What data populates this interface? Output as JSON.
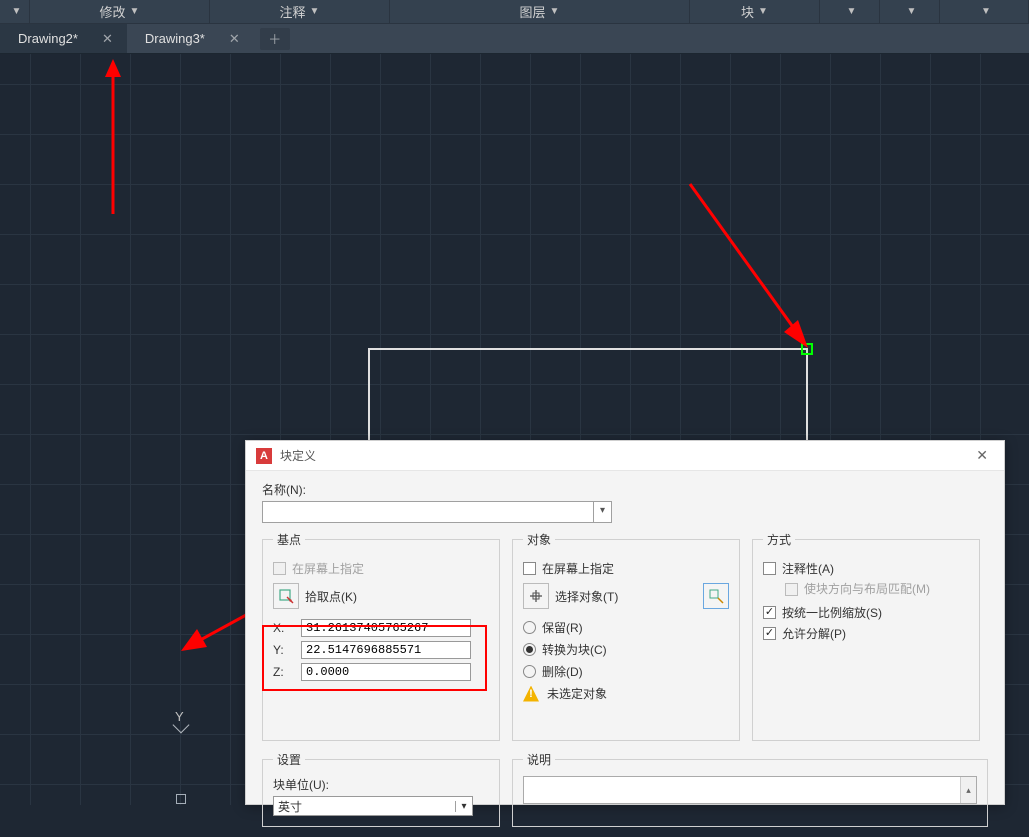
{
  "ribbon": {
    "modify": "修改",
    "annotate": "注释",
    "layer": "图层",
    "block": "块"
  },
  "tabs": {
    "drawing2": "Drawing2*",
    "drawing3": "Drawing3*"
  },
  "canvas": {
    "y_label": "Y"
  },
  "dialog": {
    "title": "块定义",
    "name_label": "名称(N):",
    "name_value": "",
    "base": {
      "legend": "基点",
      "on_screen": "在屏幕上指定",
      "pick_point": "拾取点(K)",
      "x_label": "X:",
      "x_value": "31.26137405765267",
      "y_label": "Y:",
      "y_value": "22.5147696885571",
      "z_label": "Z:",
      "z_value": "0.0000"
    },
    "objects": {
      "legend": "对象",
      "on_screen": "在屏幕上指定",
      "select": "选择对象(T)",
      "retain": "保留(R)",
      "convert": "转换为块(C)",
      "delete": "删除(D)",
      "none_selected": "未选定对象"
    },
    "behavior": {
      "legend": "方式",
      "annotative": "注释性(A)",
      "match_orientation": "使块方向与布局匹配(M)",
      "scale_uniform": "按统一比例缩放(S)",
      "allow_explode": "允许分解(P)"
    },
    "settings": {
      "legend": "设置",
      "unit_label": "块单位(U):",
      "unit_value": "英寸"
    },
    "description": {
      "legend": "说明"
    }
  }
}
